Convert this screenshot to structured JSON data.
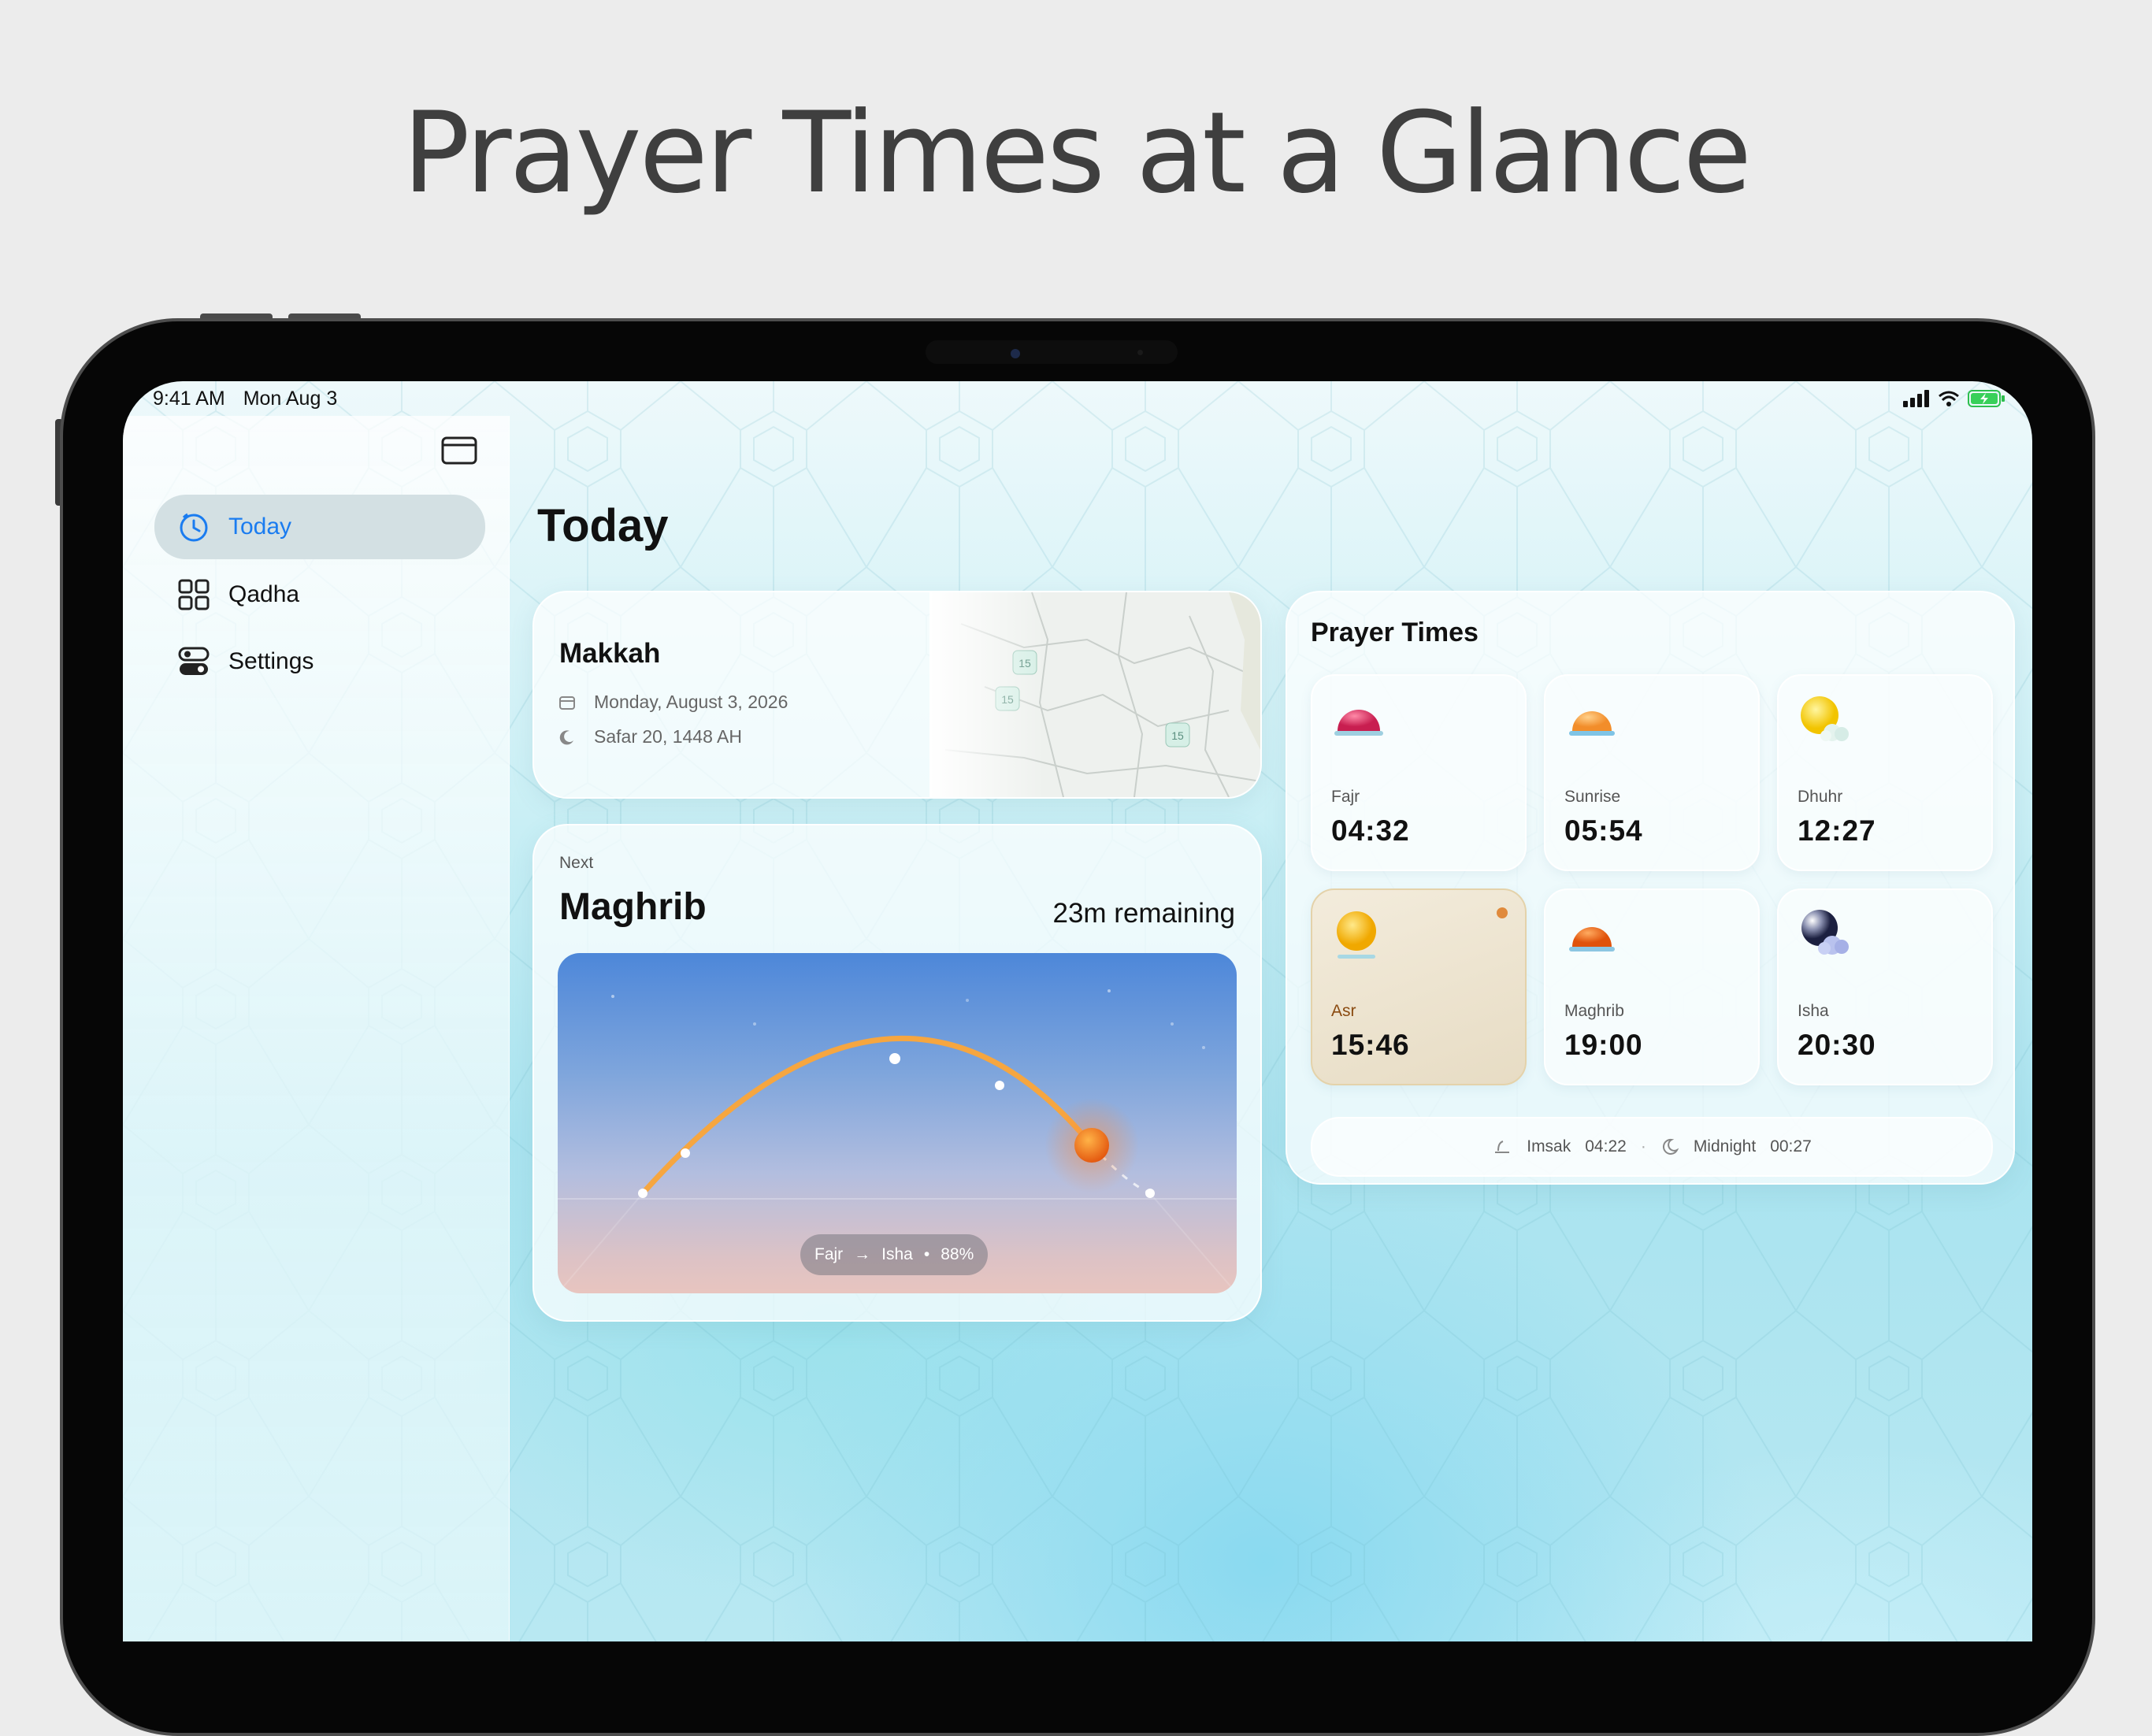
{
  "headline": "Prayer Times at a Glance",
  "status_bar": {
    "time": "9:41 AM",
    "date": "Mon Aug 3"
  },
  "sidebar": {
    "items": [
      {
        "label": "Today",
        "icon": "clock-icon",
        "active": true
      },
      {
        "label": "Qadha",
        "icon": "grid-icon",
        "active": false
      },
      {
        "label": "Settings",
        "icon": "toggles-icon",
        "active": false
      }
    ]
  },
  "page_title": "Today",
  "location": {
    "city": "Makkah",
    "gregorian_date": "Monday, August 3, 2026",
    "hijri_date": "Safar 20, 1448 AH",
    "map_route_labels": [
      "15",
      "15",
      "15"
    ]
  },
  "next_prayer": {
    "label": "Next",
    "name": "Maghrib",
    "remaining": "23m remaining",
    "arc": {
      "from": "Fajr",
      "to": "Isha",
      "progress_text": "88%",
      "progress": 0.88
    }
  },
  "prayer_times": {
    "title": "Prayer Times",
    "items": [
      {
        "name": "Fajr",
        "time": "04:32",
        "icon": "dawn-sun-icon",
        "active": false
      },
      {
        "name": "Sunrise",
        "time": "05:54",
        "icon": "sunrise-icon",
        "active": false
      },
      {
        "name": "Dhuhr",
        "time": "12:27",
        "icon": "sun-cloud-icon",
        "active": false
      },
      {
        "name": "Asr",
        "time": "15:46",
        "icon": "sun-icon",
        "active": true
      },
      {
        "name": "Maghrib",
        "time": "19:00",
        "icon": "sunset-icon",
        "active": false
      },
      {
        "name": "Isha",
        "time": "20:30",
        "icon": "moon-cloud-icon",
        "active": false
      }
    ],
    "imsak": {
      "label": "Imsak",
      "time": "04:22"
    },
    "midnight": {
      "label": "Midnight",
      "time": "00:27"
    }
  },
  "colors": {
    "accent": "#1a7cf0",
    "arc": "#f5a23a",
    "sun": "#ef6a10"
  }
}
